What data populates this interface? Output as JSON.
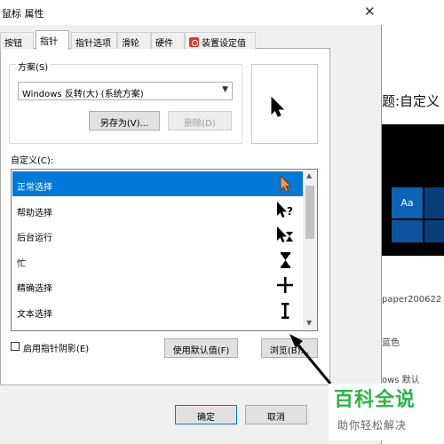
{
  "dialog": {
    "title": "鼠标 属性",
    "close_glyph": "✕",
    "tabs": [
      {
        "label": "按钮"
      },
      {
        "label": "指针"
      },
      {
        "label": "指针选项"
      },
      {
        "label": "滑轮"
      },
      {
        "label": "硬件"
      },
      {
        "label": "装置设定值"
      }
    ],
    "scheme": {
      "label": "方案(S)",
      "selected": "Windows 反转(大) (系统方案)",
      "save_as_label": "另存为(V)...",
      "delete_label": "删除(D)"
    },
    "custom": {
      "label": "自定义(C):",
      "items": [
        {
          "label": "正常选择",
          "cursor": "arrow-cursor-icon",
          "selected": true
        },
        {
          "label": "帮助选择",
          "cursor": "help-cursor-icon",
          "selected": false
        },
        {
          "label": "后台运行",
          "cursor": "working-cursor-icon",
          "selected": false
        },
        {
          "label": "忙",
          "cursor": "busy-cursor-icon",
          "selected": false
        },
        {
          "label": "精确选择",
          "cursor": "crosshair-cursor-icon",
          "selected": false
        },
        {
          "label": "文本选择",
          "cursor": "ibeam-cursor-icon",
          "selected": false
        }
      ]
    },
    "shadow_checkbox": {
      "label": "启用指针阴影(E)",
      "checked": false
    },
    "use_default_label": "使用默认值(F)",
    "browse_label": "浏览(B)...",
    "ok_label": "确定",
    "cancel_label": "取消"
  },
  "background_window": {
    "heading": "题:自定义",
    "tile_label": "Aa",
    "text_1": "paper200622",
    "text_2": "蓝色",
    "text_3": "ows 默认"
  },
  "watermark": {
    "main": "百科全说",
    "sub": "助你轻松解决"
  },
  "colors": {
    "selection": "#0078d7",
    "accent_cursor": "#f39c4a",
    "watermark_green": "#2db34a"
  }
}
